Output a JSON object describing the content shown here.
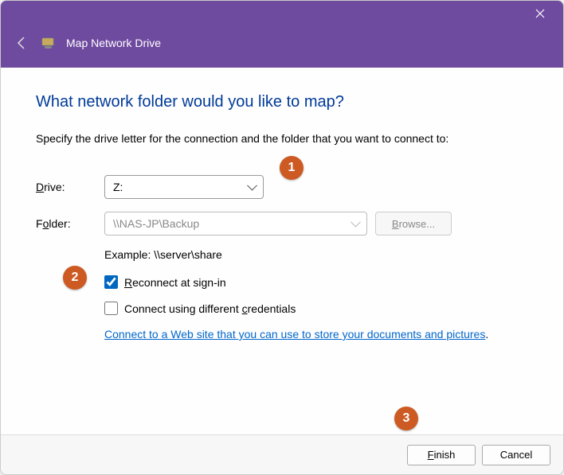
{
  "window": {
    "title": "Map Network Drive"
  },
  "heading": "What network folder would you like to map?",
  "subtitle": "Specify the drive letter for the connection and the folder that you want to connect to:",
  "form": {
    "drive_label_pre": "D",
    "drive_label_post": "rive:",
    "drive_value": "Z:",
    "folder_label_pre": "F",
    "folder_label_mid": "o",
    "folder_label_post": "lder:",
    "folder_value": "\\\\NAS-JP\\Backup",
    "browse_pre": "B",
    "browse_post": "rowse...",
    "example": "Example: \\\\server\\share",
    "reconnect_pre": "R",
    "reconnect_post": "econnect at sign-in",
    "reconnect_checked": true,
    "diffcred_pre": "Connect using different ",
    "diffcred_mid": "c",
    "diffcred_post": "redentials",
    "diffcred_checked": false,
    "link_text": "Connect to a Web site that you can use to store your documents and pictures",
    "link_tail": "."
  },
  "footer": {
    "finish_pre": "F",
    "finish_post": "inish",
    "cancel": "Cancel"
  },
  "annotations": {
    "b1": "1",
    "b2": "2",
    "b3": "3"
  }
}
